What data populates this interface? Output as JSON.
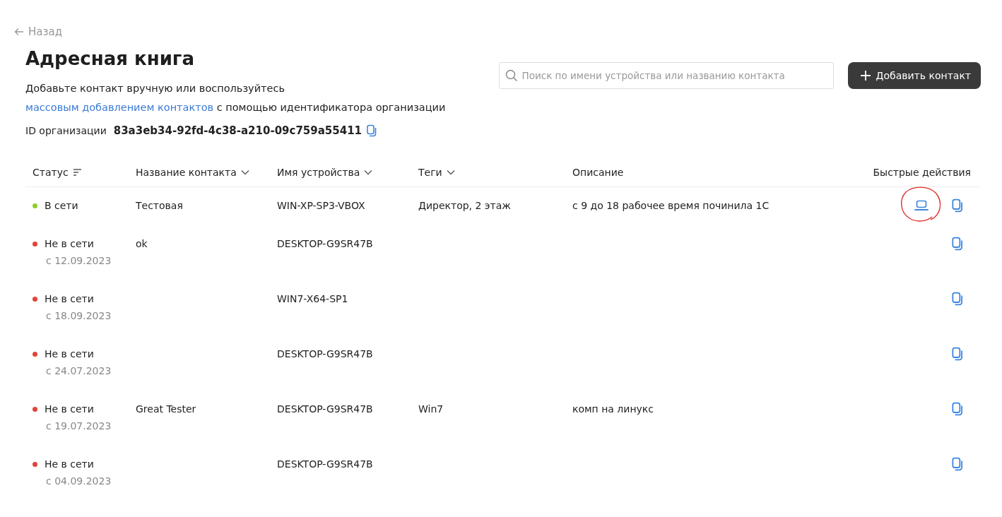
{
  "back_link": "Назад",
  "title": "Адресная книга",
  "intro": {
    "before": "Добавьте контакт вручную или воспользуйтесь ",
    "link": "массовым добавлением контактов",
    "after": " с помощью идентификатора организации"
  },
  "org_id": {
    "label": "ID организации",
    "value": "83a3eb34-92fd-4c38-a210-09c759a55411"
  },
  "search": {
    "placeholder": "Поиск по имени устройства или названию контакта"
  },
  "add_button": "Добавить контакт",
  "table": {
    "columns": [
      {
        "label": "Статус",
        "kind": "filter"
      },
      {
        "label": "Название контакта",
        "kind": "sort"
      },
      {
        "label": "Имя устройства",
        "kind": "sort"
      },
      {
        "label": "Теги",
        "kind": "sort"
      },
      {
        "label": "Описание",
        "kind": "plain"
      },
      {
        "label": "Быстрые действия",
        "kind": "plain"
      }
    ],
    "rows": [
      {
        "online": true,
        "status": "В сети",
        "since": null,
        "contact": "Тестовая",
        "device": "WIN-XP-SP3-VBOX",
        "tags": "Директор, 2 этаж",
        "description": "с 9 до 18 рабочее время починила 1С",
        "quick_actions": [
          {
            "kind": "connect",
            "circled": true
          },
          {
            "kind": "copy"
          }
        ]
      },
      {
        "online": false,
        "status": "Не в сети",
        "since": "с 12.09.2023",
        "contact": "ok",
        "device": "DESKTOP-G9SR47B",
        "tags": null,
        "description": null,
        "quick_actions": [
          {
            "kind": "copy"
          }
        ]
      },
      {
        "online": false,
        "status": "Не в сети",
        "since": "с 18.09.2023",
        "contact": null,
        "device": "WIN7-X64-SP1",
        "tags": null,
        "description": null,
        "quick_actions": [
          {
            "kind": "copy"
          }
        ]
      },
      {
        "online": false,
        "status": "Не в сети",
        "since": "с 24.07.2023",
        "contact": null,
        "device": "DESKTOP-G9SR47B",
        "tags": null,
        "description": null,
        "quick_actions": [
          {
            "kind": "copy"
          }
        ]
      },
      {
        "online": false,
        "status": "Не в сети",
        "since": "с 19.07.2023",
        "contact": "Great Tester",
        "device": "DESKTOP-G9SR47B",
        "tags": "Win7",
        "description": "комп на линукс",
        "quick_actions": [
          {
            "kind": "copy"
          }
        ]
      },
      {
        "online": false,
        "status": "Не в сети",
        "since": "с 04.09.2023",
        "contact": null,
        "device": "DESKTOP-G9SR47B",
        "tags": null,
        "description": null,
        "quick_actions": [
          {
            "kind": "copy"
          }
        ]
      }
    ]
  }
}
